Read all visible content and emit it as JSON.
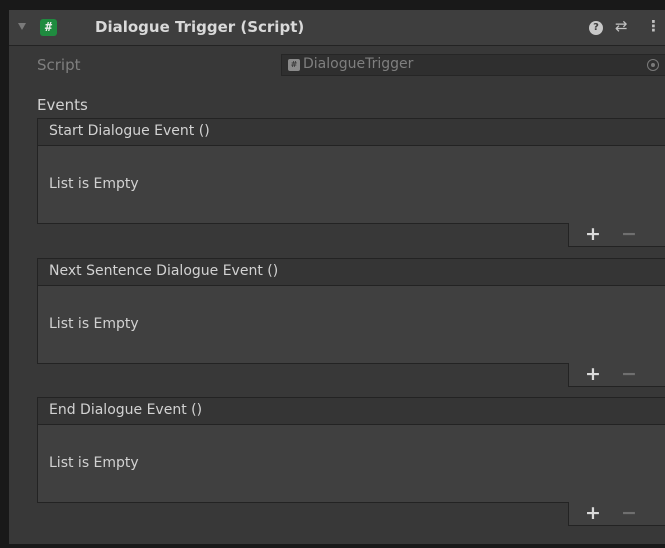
{
  "component": {
    "title": "Dialogue Trigger (Script)",
    "icon": "script-hash-icon",
    "icon_glyph": "#",
    "help_glyph": "?",
    "presets_glyph": "⇄",
    "menu_glyph": "⋮"
  },
  "script_row": {
    "label": "Script",
    "value": "DialogueTrigger",
    "field_icon_glyph": "#"
  },
  "events_label": "Events",
  "events": [
    {
      "title": "Start Dialogue Event ()",
      "empty_text": "List is Empty",
      "add_label": "+",
      "remove_label": "−"
    },
    {
      "title": "Next Sentence Dialogue Event ()",
      "empty_text": "List is Empty",
      "add_label": "+",
      "remove_label": "−"
    },
    {
      "title": "End Dialogue Event ()",
      "empty_text": "List is Empty",
      "add_label": "+",
      "remove_label": "−"
    }
  ],
  "colors": {
    "panel_bg": "#383838",
    "header_bg": "#3e3e3e",
    "script_icon_green": "#1f8b3f",
    "text_primary": "#d2d2d2",
    "text_disabled": "#7f7f7f"
  }
}
